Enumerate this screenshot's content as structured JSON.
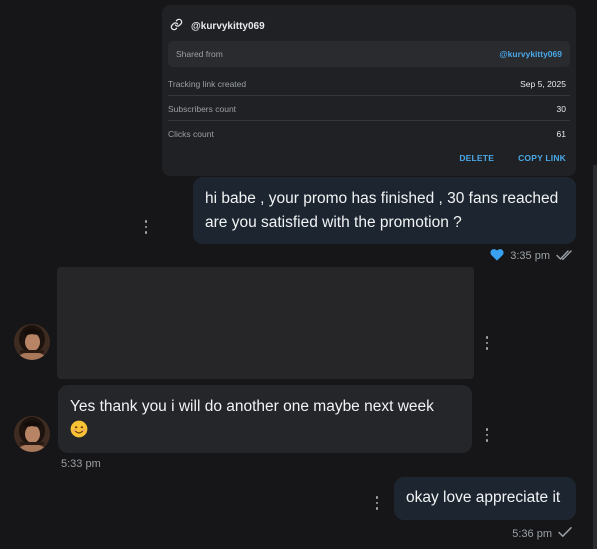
{
  "tracking": {
    "username": "@kurvykitty069",
    "icon": "link-icon",
    "shared_from_label": "Shared from",
    "shared_from_value": "@kurvykitty069",
    "rows": [
      {
        "label": "Tracking link created",
        "value": "Sep 5, 2025"
      },
      {
        "label": "Subscribers count",
        "value": "30"
      },
      {
        "label": "Clicks count",
        "value": "61"
      }
    ],
    "delete_label": "DELETE",
    "copy_label": "COPY LINK",
    "accent_color": "#4aa8e8"
  },
  "messages": {
    "m1": {
      "text_line1": "hi babe , your promo has finished , 30 fans reached",
      "text_line2": "are you satisfied with the promotion ?",
      "time": "3:35 pm",
      "liked": true,
      "status": "double-check-icon"
    },
    "m2": {
      "text": "Yes thank you i will do another one maybe next week",
      "emoji": "😊",
      "time": "5:33 pm"
    },
    "m3": {
      "text": "okay love appreciate it",
      "time": "5:36 pm",
      "status": "check-icon"
    }
  },
  "colors": {
    "background": "#161618",
    "outgoing_bubble": "#1d2630",
    "incoming_bubble": "#25262a",
    "heart": "#3aa0f0"
  }
}
